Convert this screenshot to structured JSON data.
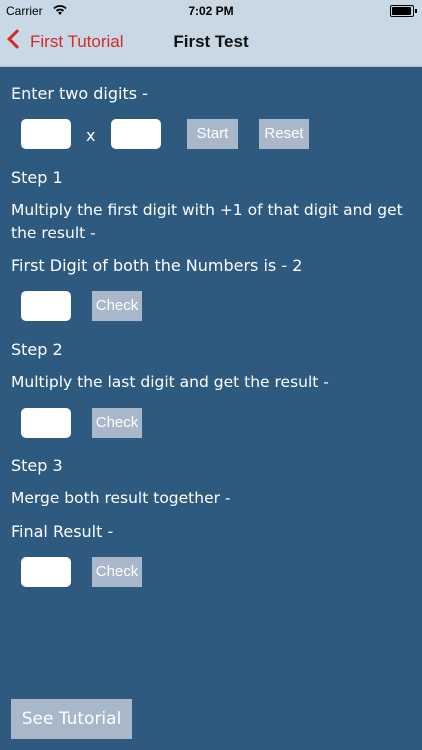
{
  "status": {
    "carrier": "Carrier",
    "time": "7:02 PM"
  },
  "nav": {
    "back_label": "First Tutorial",
    "title": "First Test"
  },
  "main": {
    "enter_label": "Enter two digits -",
    "times_symbol": "x",
    "start_label": "Start",
    "reset_label": "Reset",
    "step1_title": "Step 1",
    "step1_desc_line1": "Multiply the first digit with +1 of that digit and get",
    "step1_desc_line2": "the result -",
    "first_digit_label": "First Digit of both the Numbers is - 2",
    "check_label": "Check",
    "step2_title": "Step 2",
    "step2_desc": "Multiply the last digit and get the result -",
    "step3_title": "Step 3",
    "step3_desc": "Merge both result together -",
    "final_label": "Final Result -",
    "see_tutorial_label": "See Tutorial"
  }
}
